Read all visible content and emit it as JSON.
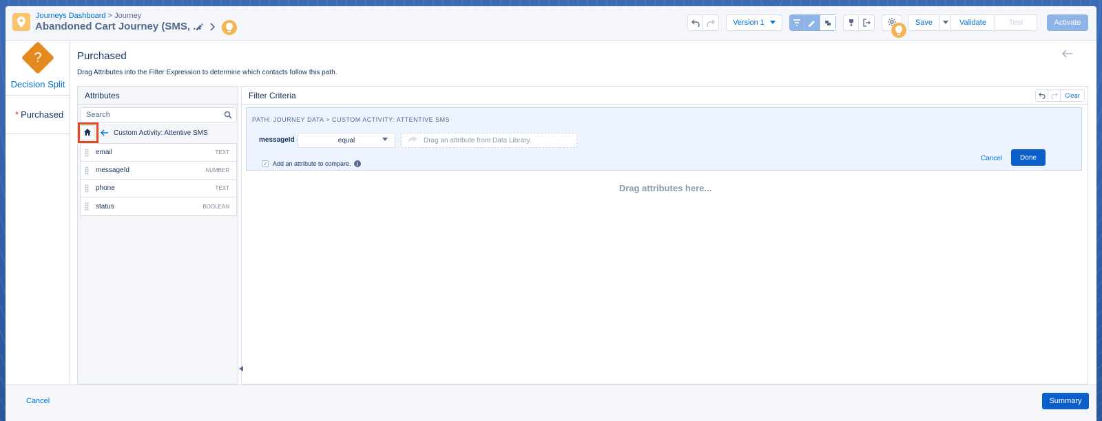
{
  "header": {
    "breadcrumb_link": "Journeys Dashboard",
    "breadcrumb_sep": ">",
    "breadcrumb_current": "Journey",
    "title": "Abandoned Cart Journey (SMS, ...",
    "version_label": "Version 1",
    "save_label": "Save",
    "validate_label": "Validate",
    "test_label": "Test",
    "activate_label": "Activate"
  },
  "rail": {
    "activity_label": "Decision Split",
    "activity_icon": "?",
    "required_mark": "*",
    "path_label": "Purchased"
  },
  "main": {
    "title": "Purchased",
    "subtitle": "Drag Attributes into the Filter Expression to determine which contacts follow this path."
  },
  "attributes": {
    "heading": "Attributes",
    "search_placeholder": "Search",
    "path": "Custom Activity: Attentive SMS",
    "items": [
      {
        "name": "email",
        "type": "TEXT"
      },
      {
        "name": "messageId",
        "type": "NUMBER"
      },
      {
        "name": "phone",
        "type": "TEXT"
      },
      {
        "name": "status",
        "type": "BOOLEAN"
      }
    ]
  },
  "filter": {
    "heading": "Filter Criteria",
    "clear_label": "Clear",
    "path_label": "PATH: JOURNEY DATA > CUSTOM ACTIVITY: ATTENTIVE SMS",
    "field": "messageId",
    "operator": "equal",
    "drop_placeholder": "Drag an attribute from Data Library.",
    "compare_label": "Add an attribute to compare.",
    "cancel_label": "Cancel",
    "done_label": "Done",
    "empty_hint": "Drag attributes here..."
  },
  "footer": {
    "cancel_label": "Cancel",
    "summary_label": "Summary"
  },
  "colors": {
    "accent": "#0070d2",
    "primary_button": "#0b5fca",
    "decision_icon": "#e4891e",
    "highlight": "#e04a1f"
  }
}
